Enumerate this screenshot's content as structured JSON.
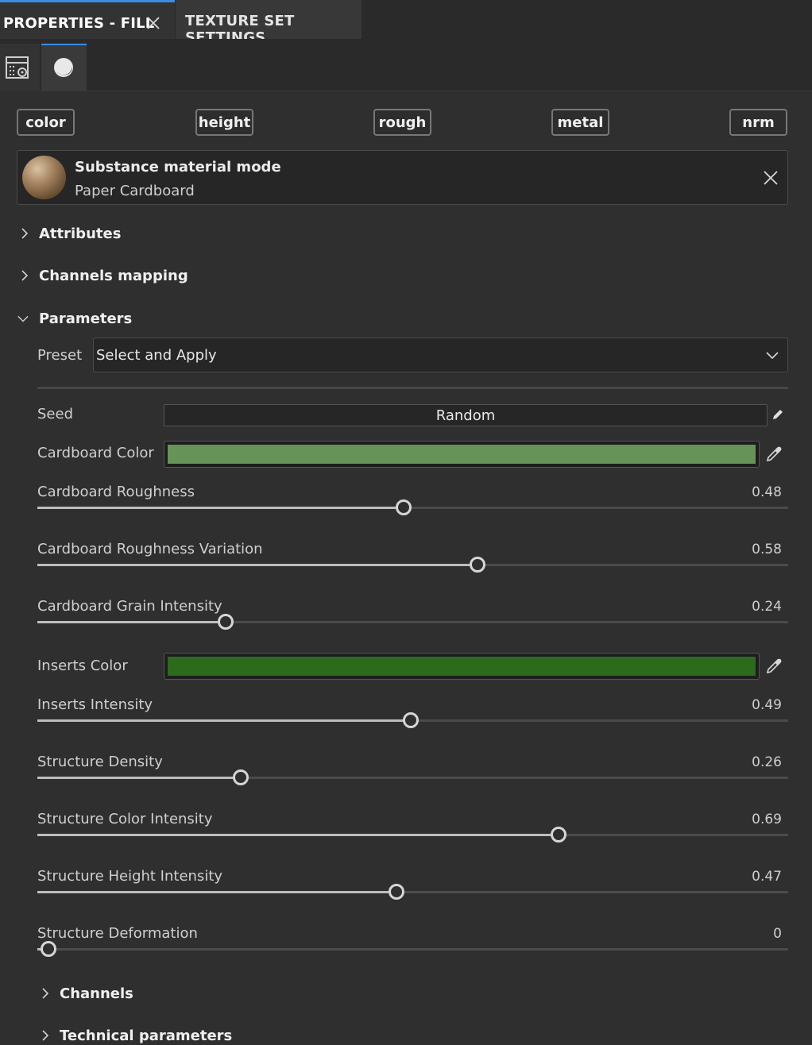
{
  "tabs": {
    "active_label": "PROPERTIES - FILL",
    "inactive_label": "TEXTURE SET SETTINGS"
  },
  "channels": [
    "color",
    "height",
    "rough",
    "metal",
    "nrm"
  ],
  "material": {
    "mode_label": "Substance material mode",
    "name": "Paper Cardboard"
  },
  "sections": {
    "attributes": "Attributes",
    "channels_mapping": "Channels mapping",
    "parameters": "Parameters",
    "channels": "Channels",
    "technical_parameters": "Technical parameters"
  },
  "preset": {
    "label": "Preset",
    "value": "Select and Apply"
  },
  "seed": {
    "label": "Seed",
    "value": "Random"
  },
  "cardboard_color": {
    "label": "Cardboard Color",
    "color": "#669357"
  },
  "inserts_color": {
    "label": "Inserts Color",
    "color": "#2c6a1c"
  },
  "sliders_a": [
    {
      "label": "Cardboard Roughness",
      "value": "0.48",
      "fraction": 0.48
    },
    {
      "label": "Cardboard Roughness Variation",
      "value": "0.58",
      "fraction": 0.58
    },
    {
      "label": "Cardboard Grain Intensity",
      "value": "0.24",
      "fraction": 0.24
    }
  ],
  "sliders_b": [
    {
      "label": "Inserts Intensity",
      "value": "0.49",
      "fraction": 0.49
    },
    {
      "label": "Structure Density",
      "value": "0.26",
      "fraction": 0.26
    },
    {
      "label": "Structure Color Intensity",
      "value": "0.69",
      "fraction": 0.69
    },
    {
      "label": "Structure Height Intensity",
      "value": "0.47",
      "fraction": 0.47
    },
    {
      "label": "Structure Deformation",
      "value": "0",
      "fraction": 0
    }
  ],
  "colors": {
    "accent": "#3c8de0",
    "background": "#2f2f2f"
  }
}
